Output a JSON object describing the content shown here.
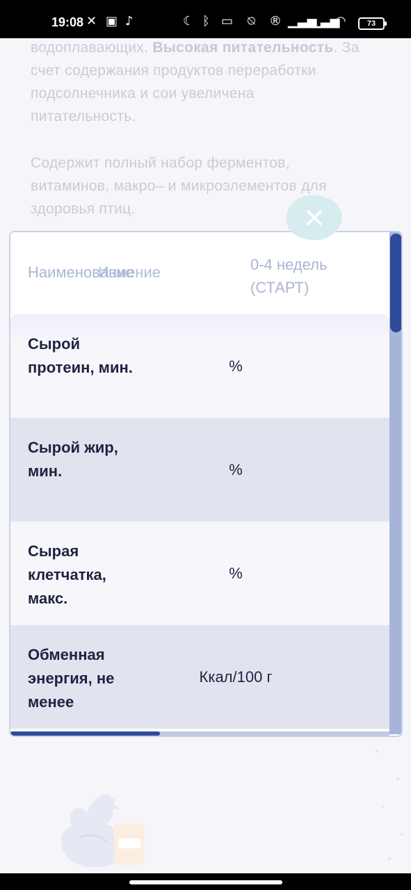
{
  "status_bar": {
    "time": "19:08",
    "battery": "73",
    "icons": [
      "x-icon",
      "grid-app-icon",
      "tiktok-icon",
      "moon-icon",
      "bluetooth-icon",
      "vibrate-icon",
      "alarm-off-icon",
      "r-icon",
      "signal-icon",
      "signal-icon",
      "wifi-icon",
      "battery-icon"
    ]
  },
  "background": {
    "para1_line1_prefix": "водоплавающих. ",
    "para1_bold": "Высокая питательность",
    "para1_line1_suffix": ". За",
    "para1_line2": "счет содержания продуктов переработки",
    "para1_line3": "подсолнечника и сои увеличена",
    "para1_line4": "питательность.",
    "para2_line1": "Содержит полный набор ферментов,",
    "para2_line2": "витаминов, макро– и микроэлементов для",
    "para2_line3": "здоровья птиц."
  },
  "table": {
    "header_name": "Наименование",
    "header_unit": "Измение",
    "header_period": "0-4 недель (СТАРТ)",
    "rows": [
      {
        "name": "Сырой протеин, мин.",
        "unit": "%"
      },
      {
        "name": "Сырой жир, мин.",
        "unit": "%"
      },
      {
        "name": "Сырая клетчатка, макс.",
        "unit": "%"
      },
      {
        "name": "Обменная энергия, не менее",
        "unit": "Ккал/100 г"
      }
    ]
  },
  "scroll": {
    "vertical_position": 0.0,
    "horizontal_position": 0.0
  },
  "colors": {
    "accent": "#2e4a9a",
    "close_button": "#d6ecef",
    "row_dark": "#e1e3ef",
    "text": "#1e2340"
  }
}
